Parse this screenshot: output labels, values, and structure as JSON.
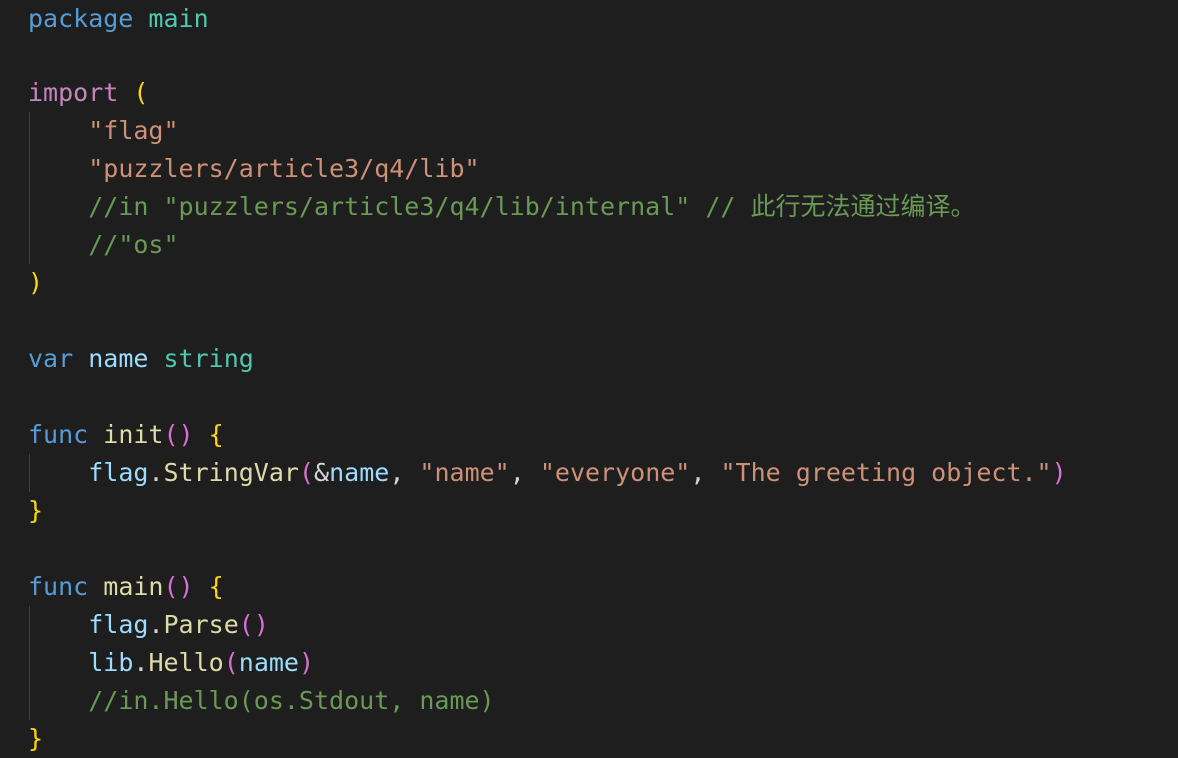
{
  "editor": {
    "language": "go",
    "theme_colors": {
      "background": "#1e1e1e",
      "keyword": "#569cd6",
      "control_keyword": "#c586c0",
      "type": "#4ec9b0",
      "string": "#ce9178",
      "comment": "#6a9955",
      "variable": "#9cdcfe",
      "function": "#dcdcaa",
      "bracket_1": "#ffd700",
      "bracket_2": "#da70d6"
    },
    "lines": {
      "l1": {
        "kw": "package",
        "name": "main"
      },
      "l3": {
        "kw": "import",
        "open": "("
      },
      "l4": {
        "str": "\"flag\""
      },
      "l5": {
        "str": "\"puzzlers/article3/q4/lib\""
      },
      "l6": {
        "comment": "//in \"puzzlers/article3/q4/lib/internal\" // 此行无法通过编译。"
      },
      "l7": {
        "comment": "//\"os\""
      },
      "l8": {
        "close": ")"
      },
      "l10": {
        "kw": "var",
        "name": "name",
        "type": "string"
      },
      "l12": {
        "kw": "func",
        "fn": "init",
        "parens": "()",
        "brace": "{"
      },
      "l13": {
        "obj": "flag",
        "dot": ".",
        "method": "StringVar",
        "open": "(",
        "amp": "&",
        "arg1": "name",
        "comma1": ", ",
        "arg2": "\"name\"",
        "comma2": ", ",
        "arg3": "\"everyone\"",
        "comma3": ", ",
        "arg4": "\"The greeting object.\"",
        "close": ")"
      },
      "l14": {
        "brace": "}"
      },
      "l16": {
        "kw": "func",
        "fn": "main",
        "parens": "()",
        "brace": "{"
      },
      "l17": {
        "obj": "flag",
        "dot": ".",
        "method": "Parse",
        "parens": "()"
      },
      "l18": {
        "obj": "lib",
        "dot": ".",
        "method": "Hello",
        "open": "(",
        "arg": "name",
        "close": ")"
      },
      "l19": {
        "comment": "//in.Hello(os.Stdout, name)"
      },
      "l20": {
        "brace": "}"
      }
    }
  }
}
